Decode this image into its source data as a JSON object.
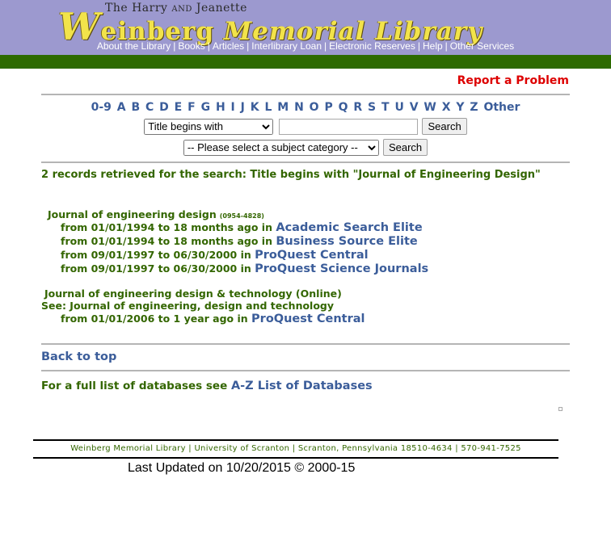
{
  "header": {
    "logo_line1": "The Harry",
    "logo_and": "AND",
    "logo_line1b": "Jeanette",
    "logo_w": "W",
    "logo_rest1": "einberg",
    "logo_memorial": "Memorial",
    "logo_library": "Library",
    "nav": [
      "About the Library",
      "Books",
      "Articles",
      "Interlibrary Loan",
      "Electronic Reserves",
      "Help",
      "Other Services"
    ]
  },
  "report_problem": "Report a Problem",
  "alphabet": [
    "0-9",
    "A",
    "B",
    "C",
    "D",
    "E",
    "F",
    "G",
    "H",
    "I",
    "J",
    "K",
    "L",
    "M",
    "N",
    "O",
    "P",
    "Q",
    "R",
    "S",
    "T",
    "U",
    "V",
    "W",
    "X",
    "Y",
    "Z",
    "Other"
  ],
  "search": {
    "type_selected": "Title begins with",
    "query_value": "",
    "search_label": "Search",
    "subject_selected": "-- Please select a subject category --",
    "subject_search_label": "Search"
  },
  "result_summary": "2 records retrieved for the search: Title begins with \"Journal of Engineering Design\"",
  "results": [
    {
      "title": "Journal of engineering design",
      "issn": "(0954-4828)",
      "holdings": [
        {
          "text": "from 01/01/1994 to 18 months ago in",
          "db": "Academic Search Elite"
        },
        {
          "text": "from 01/01/1994 to 18 months ago in",
          "db": "Business Source Elite"
        },
        {
          "text": "from 09/01/1997 to 06/30/2000 in",
          "db": "ProQuest Central"
        },
        {
          "text": "from 09/01/1997 to 06/30/2000 in",
          "db": "ProQuest Science Journals"
        }
      ]
    },
    {
      "title": "Journal of engineering design & technology (Online)",
      "see": "See:  Journal of engineering, design and technology",
      "holdings": [
        {
          "text": "from 01/01/2006 to 1 year ago in",
          "db": "ProQuest Central"
        }
      ]
    }
  ],
  "back_to_top": "Back to top",
  "full_list_text": "For a full list of databases see",
  "full_list_link": "A-Z List of Databases",
  "footer": "Weinberg Memorial Library | University of Scranton | Scranton, Pennsylvania 18510-4634 | 570-941-7525",
  "last_updated": "Last Updated on 10/20/2015 © 2000-15",
  "colors": {
    "header_bg": "#9c99cf",
    "green_bar": "#2d6a00",
    "text_green": "#336600",
    "link_blue": "#3b5d9a",
    "report_red": "#dd0000"
  }
}
